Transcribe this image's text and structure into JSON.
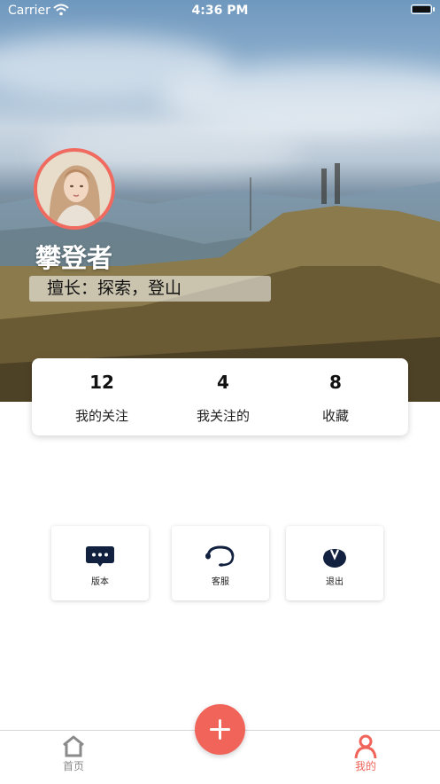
{
  "status_bar": {
    "carrier": "Carrier",
    "time": "4:36 PM"
  },
  "profile": {
    "name": "攀登者",
    "skill": "擅长：探索，登山"
  },
  "stats": [
    {
      "value": "12",
      "label": "我的关注"
    },
    {
      "value": "4",
      "label": "我关注的"
    },
    {
      "value": "8",
      "label": "收藏"
    }
  ],
  "menu": [
    {
      "label": "版本",
      "icon": "chat-bubble-icon"
    },
    {
      "label": "客服",
      "icon": "customer-service-icon"
    },
    {
      "label": "退出",
      "icon": "logout-icon"
    }
  ],
  "tabbar": {
    "home_label": "首页",
    "mine_label": "我的",
    "add_icon": "plus-icon"
  },
  "colors": {
    "accent": "#f0645a",
    "icon_dark": "#12213f",
    "tab_inactive": "#8a8a8a"
  }
}
